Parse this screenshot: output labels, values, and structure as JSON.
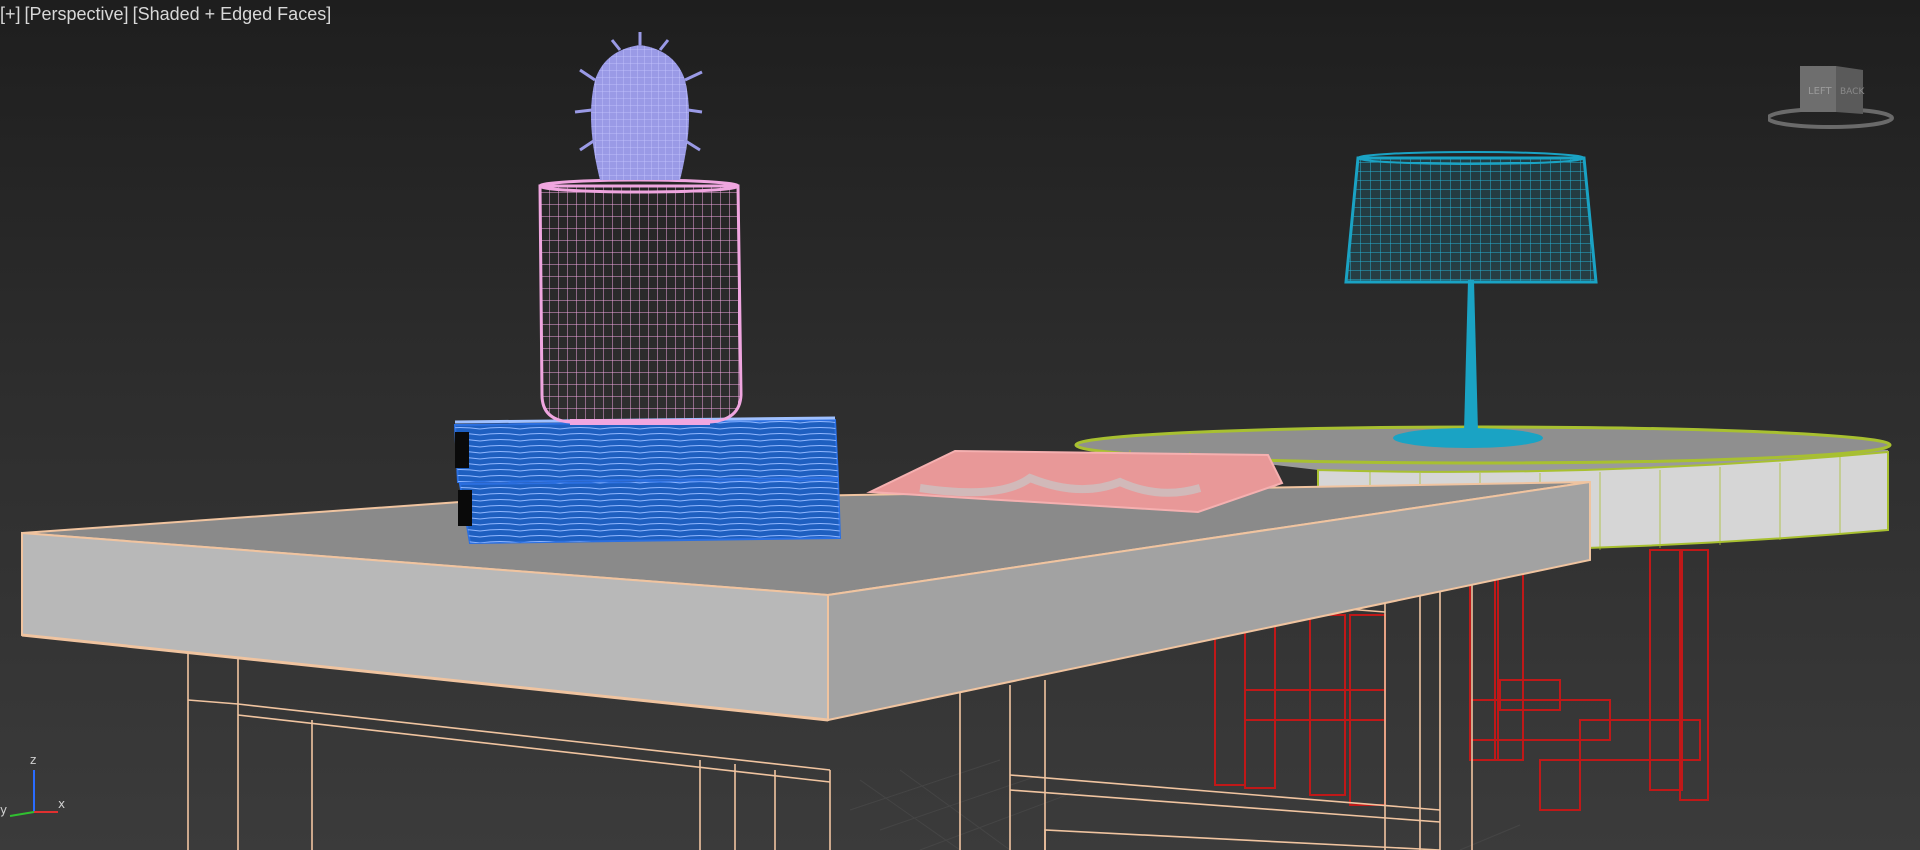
{
  "viewport": {
    "menu_label": "[+]",
    "view_label": "[Perspective]",
    "shading_label": "[Shaded + Edged Faces]"
  },
  "viewcube": {
    "face_left": "LEFT",
    "face_back": "BACK"
  },
  "axis": {
    "z": "z",
    "y": "y",
    "x": "x"
  },
  "colors": {
    "cactus": "#9a9ae6",
    "vase": "#f0a6e0",
    "books": "#1e5fc0",
    "magazine": "#e89898",
    "lamp": "#1aa3c4",
    "side_table_edge": "#a8c030",
    "front_table_edge": "#f0c4a0",
    "legs_red": "#c01818"
  }
}
